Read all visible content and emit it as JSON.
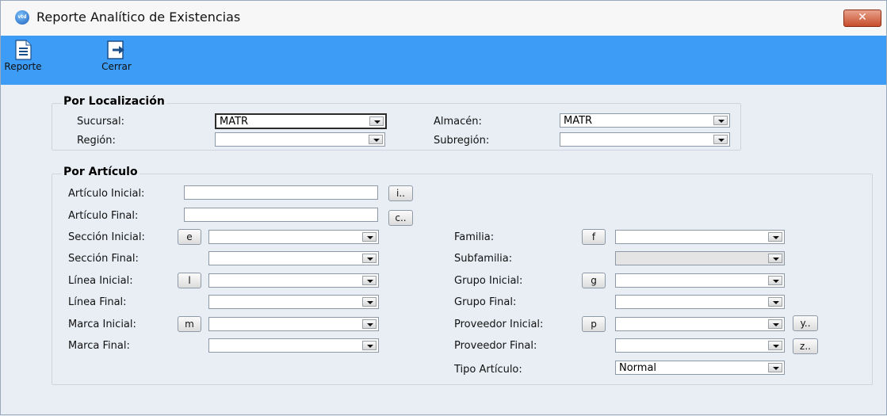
{
  "window": {
    "title": "Reporte Analítico de Existencias",
    "icon_text": "vtd",
    "close_label": "✕"
  },
  "toolbar": {
    "reporte_label": "Reporte",
    "cerrar_label": "Cerrar"
  },
  "localizacion": {
    "title": "Por Localización",
    "sucursal": {
      "label": "Sucursal:",
      "value": "MATR"
    },
    "region": {
      "label": "Región:",
      "value": ""
    },
    "almacen": {
      "label": "Almacén:",
      "value": "MATR"
    },
    "subregion": {
      "label": "Subregión:",
      "value": ""
    }
  },
  "articulo": {
    "title": "Por Artículo",
    "articulo_inicial": {
      "label": "Artículo Inicial:",
      "button": "i..",
      "value": ""
    },
    "articulo_final": {
      "label": "Artículo Final:",
      "button": "c..",
      "value": ""
    },
    "seccion_inicial": {
      "label": "Sección Inicial:",
      "button": "e",
      "value": ""
    },
    "seccion_final": {
      "label": "Sección Final:",
      "value": ""
    },
    "linea_inicial": {
      "label": "Línea Inicial:",
      "button": "l",
      "value": ""
    },
    "linea_final": {
      "label": "Línea Final:",
      "value": ""
    },
    "marca_inicial": {
      "label": "Marca Inicial:",
      "button": "m",
      "value": ""
    },
    "marca_final": {
      "label": "Marca Final:",
      "value": ""
    },
    "familia": {
      "label": "Familia:",
      "button": "f",
      "value": ""
    },
    "subfamilia": {
      "label": "Subfamilia:",
      "value": ""
    },
    "grupo_inicial": {
      "label": "Grupo Inicial:",
      "button": "g",
      "value": ""
    },
    "grupo_final": {
      "label": "Grupo Final:",
      "value": ""
    },
    "proveedor_inicial": {
      "label": "Proveedor Inicial:",
      "button": "p",
      "side_button": "y..",
      "value": ""
    },
    "proveedor_final": {
      "label": "Proveedor Final:",
      "side_button": "z..",
      "value": ""
    },
    "tipo_articulo": {
      "label": "Tipo Artículo:",
      "value": "Normal"
    }
  }
}
